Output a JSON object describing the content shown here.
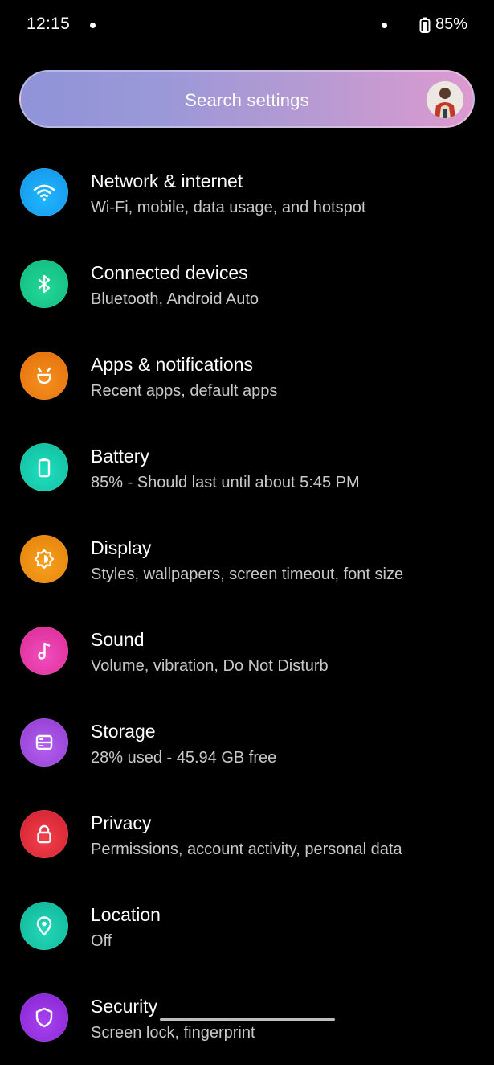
{
  "status_bar": {
    "time": "12:15",
    "battery_percent": "85%"
  },
  "search": {
    "placeholder": "Search settings"
  },
  "settings": [
    {
      "title": "Network & internet",
      "subtitle": "Wi-Fi, mobile, data usage, and hotspot",
      "icon": "wifi-icon",
      "color": "#1ea6f0"
    },
    {
      "title": "Connected devices",
      "subtitle": "Bluetooth, Android Auto",
      "icon": "bluetooth-icon",
      "color": "#16c98a"
    },
    {
      "title": "Apps & notifications",
      "subtitle": "Recent apps, default apps",
      "icon": "apps-icon",
      "color": "#ef7d12"
    },
    {
      "title": "Battery",
      "subtitle": "85% - Should last until about 5:45 PM",
      "icon": "battery-icon",
      "color": "#18cfb0"
    },
    {
      "title": "Display",
      "subtitle": "Styles, wallpapers, screen timeout, font size",
      "icon": "display-icon",
      "color": "#f0900f"
    },
    {
      "title": "Sound",
      "subtitle": "Volume, vibration, Do Not Disturb",
      "icon": "music-note-icon",
      "color": "#e83aa8"
    },
    {
      "title": "Storage",
      "subtitle": "28% used - 45.94 GB free",
      "icon": "storage-icon",
      "color": "#a548e0"
    },
    {
      "title": "Privacy",
      "subtitle": "Permissions, account activity, personal data",
      "icon": "lock-icon",
      "color": "#e8323f"
    },
    {
      "title": "Location",
      "subtitle": "Off",
      "icon": "location-pin-icon",
      "color": "#16c4a6"
    },
    {
      "title": "Security",
      "subtitle": "Screen lock, fingerprint",
      "icon": "shield-icon",
      "color": "#9b30e0"
    }
  ]
}
